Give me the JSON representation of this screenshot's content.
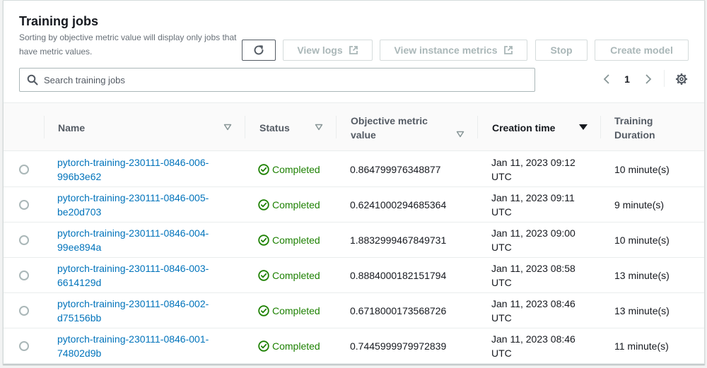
{
  "header": {
    "title": "Training jobs",
    "description": "Sorting by objective metric value will display only jobs that have metric values."
  },
  "actions": {
    "refresh_icon": "refresh-icon",
    "view_logs": "View logs",
    "view_instance_metrics": "View instance metrics",
    "stop": "Stop",
    "create_model": "Create model"
  },
  "search": {
    "placeholder": "Search training jobs",
    "value": ""
  },
  "pagination": {
    "current_page": "1"
  },
  "table": {
    "columns": {
      "name": "Name",
      "status": "Status",
      "objective": "Objective metric value",
      "creation_time": "Creation time",
      "training_duration": "Training Duration"
    },
    "sorted_by": "Creation time",
    "rows": [
      {
        "name": "pytorch-training-230111-0846-006-996b3e62",
        "status": "Completed",
        "objective": "0.864799976348877",
        "creation_time": "Jan 11, 2023 09:12 UTC",
        "duration": "10 minute(s)"
      },
      {
        "name": "pytorch-training-230111-0846-005-be20d703",
        "status": "Completed",
        "objective": "0.6241000294685364",
        "creation_time": "Jan 11, 2023 09:11 UTC",
        "duration": "9 minute(s)"
      },
      {
        "name": "pytorch-training-230111-0846-004-99ee894a",
        "status": "Completed",
        "objective": "1.8832999467849731",
        "creation_time": "Jan 11, 2023 09:00 UTC",
        "duration": "10 minute(s)"
      },
      {
        "name": "pytorch-training-230111-0846-003-6614129d",
        "status": "Completed",
        "objective": "0.8884000182151794",
        "creation_time": "Jan 11, 2023 08:58 UTC",
        "duration": "13 minute(s)"
      },
      {
        "name": "pytorch-training-230111-0846-002-d75156bb",
        "status": "Completed",
        "objective": "0.6718000173568726",
        "creation_time": "Jan 11, 2023 08:46 UTC",
        "duration": "13 minute(s)"
      },
      {
        "name": "pytorch-training-230111-0846-001-74802d9b",
        "status": "Completed",
        "objective": "0.7445999979972839",
        "creation_time": "Jan 11, 2023 08:46 UTC",
        "duration": "11 minute(s)"
      }
    ]
  },
  "colors": {
    "link": "#0073bb",
    "success": "#1d8102",
    "disabled_text": "#aab7b8",
    "border": "#d5dbdb"
  }
}
